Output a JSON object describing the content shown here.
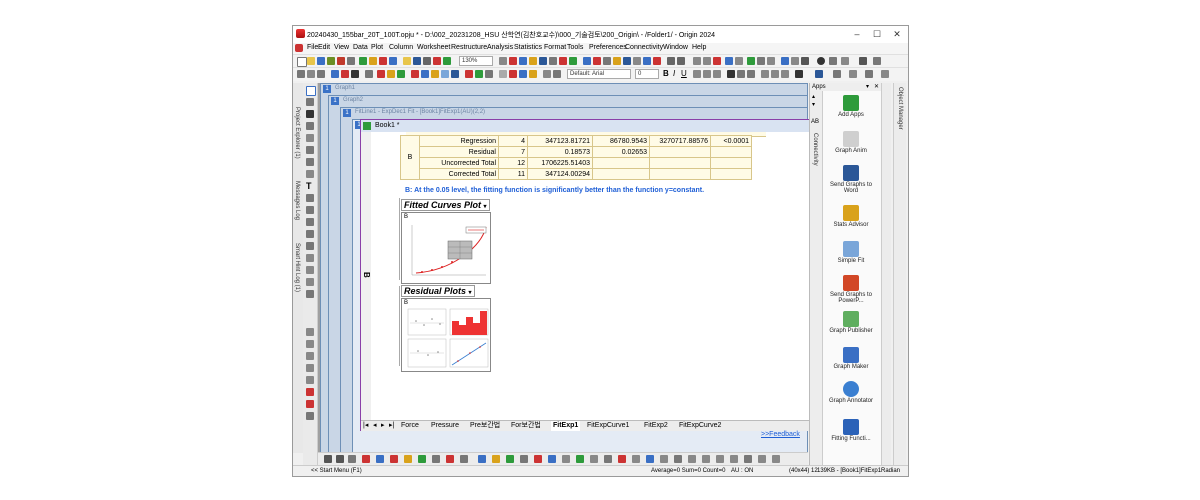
{
  "window": {
    "title": "20240430_155bar_20T_100T.opju * - D:\\002_20231208_HSU 산학연(김찬호교수)\\000_기술검토\\200_Origin\\ - /Folder1/ - Origin 2024",
    "controls": [
      "–",
      "☐",
      "✕"
    ]
  },
  "menu": [
    "File",
    "Edit",
    "View",
    "Data",
    "Plot",
    "Column",
    "Worksheet",
    "Restructure",
    "Analysis",
    "Statistics",
    "Format",
    "Tools",
    "Preferences",
    "Connectivity",
    "Window",
    "Help"
  ],
  "toolbar": {
    "zoom": "130%",
    "font_name": "Default: Arial",
    "font_size": "0"
  },
  "left_dock": [
    "Project Explorer (1)",
    "Messages Log",
    "Smart Hint Log (1)"
  ],
  "right_dock": [
    "Object Manager"
  ],
  "mdi": {
    "graph1": "Graph1",
    "graph2": "Graph2",
    "fitline": "FitLine1 - ExpDec1 Fit - [Book1]FitExp1(AU)(2,2)",
    "book_title": "Book1 *"
  },
  "anova": {
    "row_label": "B",
    "header": [
      "DF",
      "Sum of Squares",
      "Mean Square",
      "F Value",
      "Prob>F"
    ],
    "rows": [
      {
        "name": "Regression",
        "df": "4",
        "ss": "347123.81721",
        "ms": "86780.9543",
        "f": "3270717.88576",
        "p": "<0.0001"
      },
      {
        "name": "Residual",
        "df": "7",
        "ss": "0.18573",
        "ms": "0.02653",
        "f": "",
        "p": ""
      },
      {
        "name": "Uncorrected Total",
        "df": "12",
        "ss": "1706225.51403",
        "ms": "",
        "f": "",
        "p": ""
      },
      {
        "name": "Corrected Total",
        "df": "11",
        "ss": "347124.00294",
        "ms": "",
        "f": "",
        "p": ""
      }
    ],
    "note": "B: At the 0.05 level, the fitting function is significantly better than the function y=constant."
  },
  "sections": {
    "fitted_title": "Fitted Curves Plot",
    "fitted_label": "B",
    "residual_title": "Residual Plots",
    "residual_label": "B",
    "side_letter": "B"
  },
  "sheet_tabs": [
    "Force",
    "Pressure",
    "Pre보간법",
    "For보간법",
    "FitExp1",
    "FitExpCurve1",
    "FitExp2",
    "FitExpCurve2"
  ],
  "active_tab": "FitExp1",
  "feedback": ">>Feedback",
  "apps": {
    "header": "Apps",
    "tab": "Connectivity",
    "items": [
      {
        "label": "Add Apps",
        "color": "#2e9b3b"
      },
      {
        "label": "Graph Anim",
        "color": "#7a7a7a"
      },
      {
        "label": "Send Graphs to Word",
        "color": "#2b5797"
      },
      {
        "label": "Stats Advisor",
        "color": "#d9a21b"
      },
      {
        "label": "Simple Fit",
        "color": "#7aa6d9"
      },
      {
        "label": "Send Graphs to PowerP...",
        "color": "#d24726"
      },
      {
        "label": "Graph Publisher",
        "color": "#5fae5f"
      },
      {
        "label": "Graph Maker",
        "color": "#3a6fc4"
      },
      {
        "label": "Graph Annotator",
        "color": "#3a7fd1"
      },
      {
        "label": "Fitting Functi...",
        "color": "#2b62b8"
      }
    ]
  },
  "status": {
    "start": "<< Start Menu (F1)",
    "summary": "Average=0 Sum=0 Count=0",
    "au": "AU : ON",
    "dims": "(40x44) 12",
    "book": "139KB - [Book1]FitExp1",
    "unit": "Radian"
  }
}
